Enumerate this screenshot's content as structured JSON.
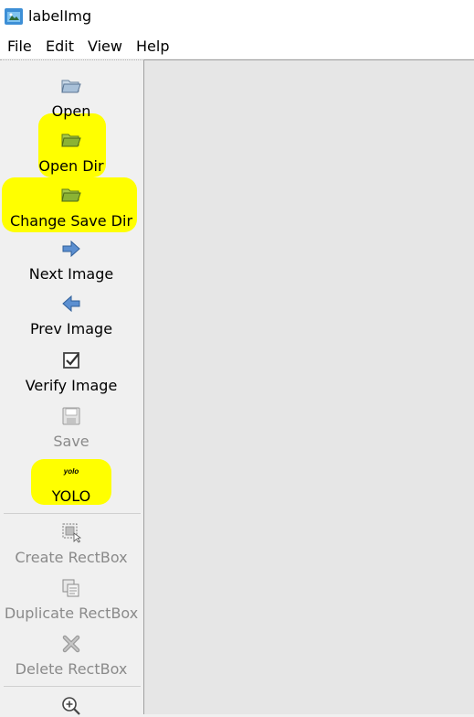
{
  "window": {
    "title": "labelImg"
  },
  "menu": [
    "File",
    "Edit",
    "View",
    "Help"
  ],
  "toolbar": {
    "open": "Open",
    "open_dir": "Open Dir",
    "change_save_dir": "Change Save Dir",
    "next_image": "Next Image",
    "prev_image": "Prev Image",
    "verify_image": "Verify Image",
    "save": "Save",
    "format_icon_text": "yolo",
    "format": "YOLO",
    "create_rectbox": "Create RectBox",
    "duplicate_rectbox": "Duplicate RectBox",
    "delete_rectbox": "Delete RectBox"
  },
  "colors": {
    "highlight": "#ffff00",
    "canvas": "#e6e6e6",
    "toolbar": "#f0f0f0",
    "disabled_text": "#8a8a8a"
  },
  "icons": [
    "folder-open-icon",
    "folder-icon",
    "arrow-right-icon",
    "arrow-left-icon",
    "checkbox-icon",
    "floppy-disk-icon",
    "yolo-format-icon",
    "rectbox-icon",
    "duplicate-icon",
    "delete-x-icon",
    "zoom-in-icon"
  ]
}
